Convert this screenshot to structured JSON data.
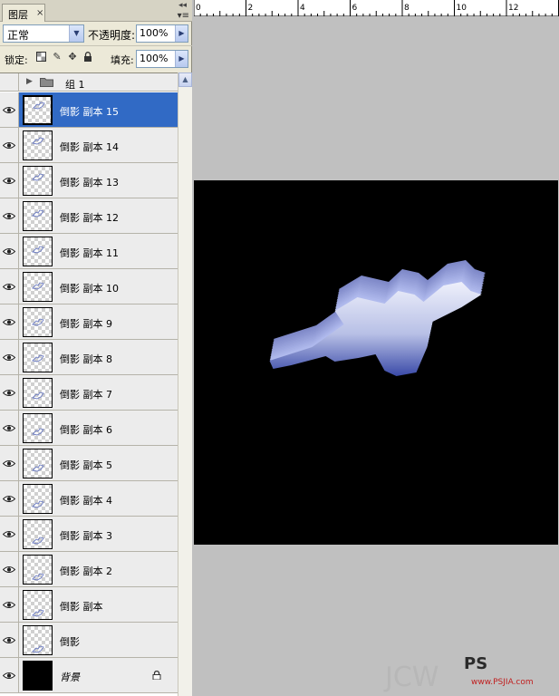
{
  "panel": {
    "tab_label": "图层",
    "tab_close": "×",
    "blend_mode": "正常",
    "opacity_label": "不透明度:",
    "opacity_value": "100%",
    "lock_label": "锁定:",
    "fill_label": "填充:",
    "fill_value": "100%"
  },
  "group": {
    "name": "组 1"
  },
  "layers": [
    {
      "name": "倒影 副本 15",
      "selected": true
    },
    {
      "name": "倒影 副本 14"
    },
    {
      "name": "倒影 副本 13"
    },
    {
      "name": "倒影 副本 12"
    },
    {
      "name": "倒影 副本 11"
    },
    {
      "name": "倒影 副本 10"
    },
    {
      "name": "倒影 副本 9"
    },
    {
      "name": "倒影 副本 8"
    },
    {
      "name": "倒影 副本 7"
    },
    {
      "name": "倒影 副本 6"
    },
    {
      "name": "倒影 副本 5"
    },
    {
      "name": "倒影 副本 4"
    },
    {
      "name": "倒影 副本 3"
    },
    {
      "name": "倒影 副本 2"
    },
    {
      "name": "倒影 副本"
    },
    {
      "name": "倒影"
    },
    {
      "name": "背景",
      "background": true
    }
  ],
  "ruler": {
    "labels": [
      "0",
      "2",
      "4",
      "6",
      "8",
      "10",
      "12"
    ]
  },
  "watermark": {
    "main": "JCW",
    "logo": "PS",
    "site": "www.PSJIA.com"
  },
  "colors": {
    "selected_row": "#316ac5",
    "canvas_bg": "#c0c0c0",
    "document_bg": "#000000"
  }
}
